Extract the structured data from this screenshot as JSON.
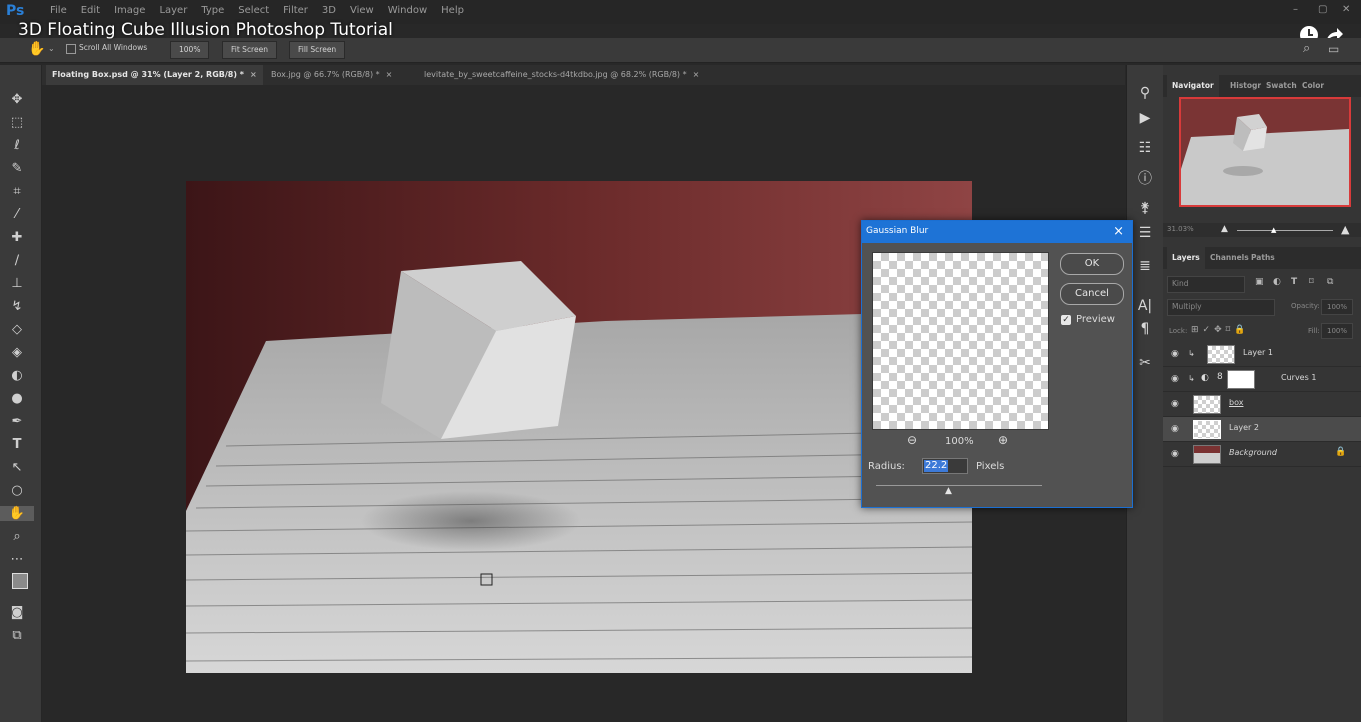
{
  "app": {
    "logo": "Ps",
    "menus": [
      "File",
      "Edit",
      "Image",
      "Layer",
      "Type",
      "Select",
      "Filter",
      "3D",
      "View",
      "Window",
      "Help"
    ]
  },
  "video_title": "3D Floating Cube Illusion Photoshop Tutorial",
  "options": {
    "scroll_all": "Scroll All Windows",
    "zoom": "100%",
    "fit": "Fit Screen",
    "fill": "Fill Screen"
  },
  "tabs": [
    {
      "label": "Floating Box.psd @ 31% (Layer 2, RGB/8) *",
      "close": "×"
    },
    {
      "label": "Box.jpg @ 66.7% (RGB/8) *",
      "close": "×"
    },
    {
      "label": "levitate_by_sweetcaffeine_stocks-d4tkdbo.jpg @ 68.2% (RGB/8) *",
      "close": "×"
    }
  ],
  "navigator": {
    "tabs": [
      "Navigator",
      "Histogr",
      "Swatch",
      "Color"
    ],
    "zoom": "31.03%"
  },
  "layers_panel": {
    "tabs": [
      "Layers",
      "Channels",
      "Paths"
    ],
    "kind": "Kind",
    "blend": "Multiply",
    "opacity_label": "Opacity:",
    "opacity": "100%",
    "lock_label": "Lock:",
    "fill_label": "Fill:",
    "fill": "100%",
    "layers": [
      {
        "name": "Layer 1"
      },
      {
        "name": "Curves 1"
      },
      {
        "name": "box"
      },
      {
        "name": "Layer 2"
      },
      {
        "name": "Background"
      }
    ]
  },
  "dialog": {
    "title": "Gaussian Blur",
    "close": "×",
    "ok": "OK",
    "cancel": "Cancel",
    "preview_label": "Preview",
    "zoom": "100%",
    "radius_label": "Radius:",
    "radius_value": "22.2",
    "units": "Pixels"
  },
  "colors": {
    "accent": "#1e73d6",
    "nav_frame": "#d83a3a"
  }
}
